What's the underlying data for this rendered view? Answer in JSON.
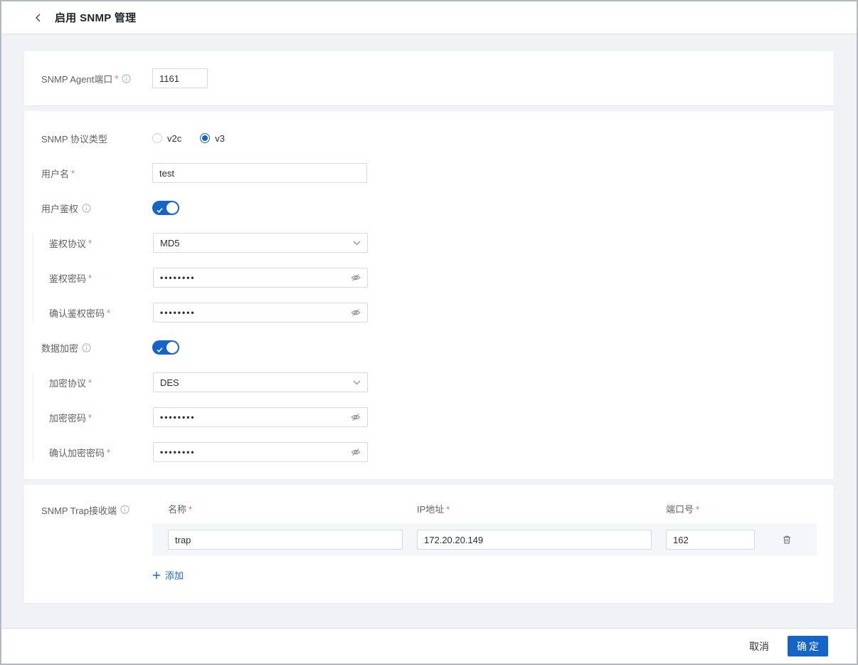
{
  "ui": {
    "required_mark": "*"
  },
  "header": {
    "title": "启用 SNMP 管理"
  },
  "agent": {
    "port_label": "SNMP Agent端口",
    "port_value": "1161"
  },
  "protocol": {
    "label": "SNMP 协议类型",
    "options": [
      {
        "label": "v2c",
        "selected": false
      },
      {
        "label": "v3",
        "selected": true
      }
    ]
  },
  "username": {
    "label": "用户名",
    "value": "test"
  },
  "auth": {
    "label": "用户鉴权",
    "enabled": true,
    "protocol": {
      "label": "鉴权协议",
      "value": "MD5"
    },
    "password": {
      "label": "鉴权密码",
      "value": "••••••••"
    },
    "confirm": {
      "label": "确认鉴权密码",
      "value": "••••••••"
    }
  },
  "privacy": {
    "label": "数据加密",
    "enabled": true,
    "protocol": {
      "label": "加密协议",
      "value": "DES"
    },
    "password": {
      "label": "加密密码",
      "value": "••••••••"
    },
    "confirm": {
      "label": "确认加密密码",
      "value": "••••••••"
    }
  },
  "trap": {
    "label": "SNMP Trap接收端",
    "columns": {
      "name": "名称",
      "ip": "IP地址",
      "port": "端口号"
    },
    "rows": [
      {
        "name": "trap",
        "ip": "172.20.20.149",
        "port": "162"
      }
    ],
    "add_label": "添加"
  },
  "footer": {
    "cancel": "取消",
    "confirm": "确定"
  },
  "colors": {
    "primary": "#1564c8",
    "danger": "#f56c6c"
  }
}
